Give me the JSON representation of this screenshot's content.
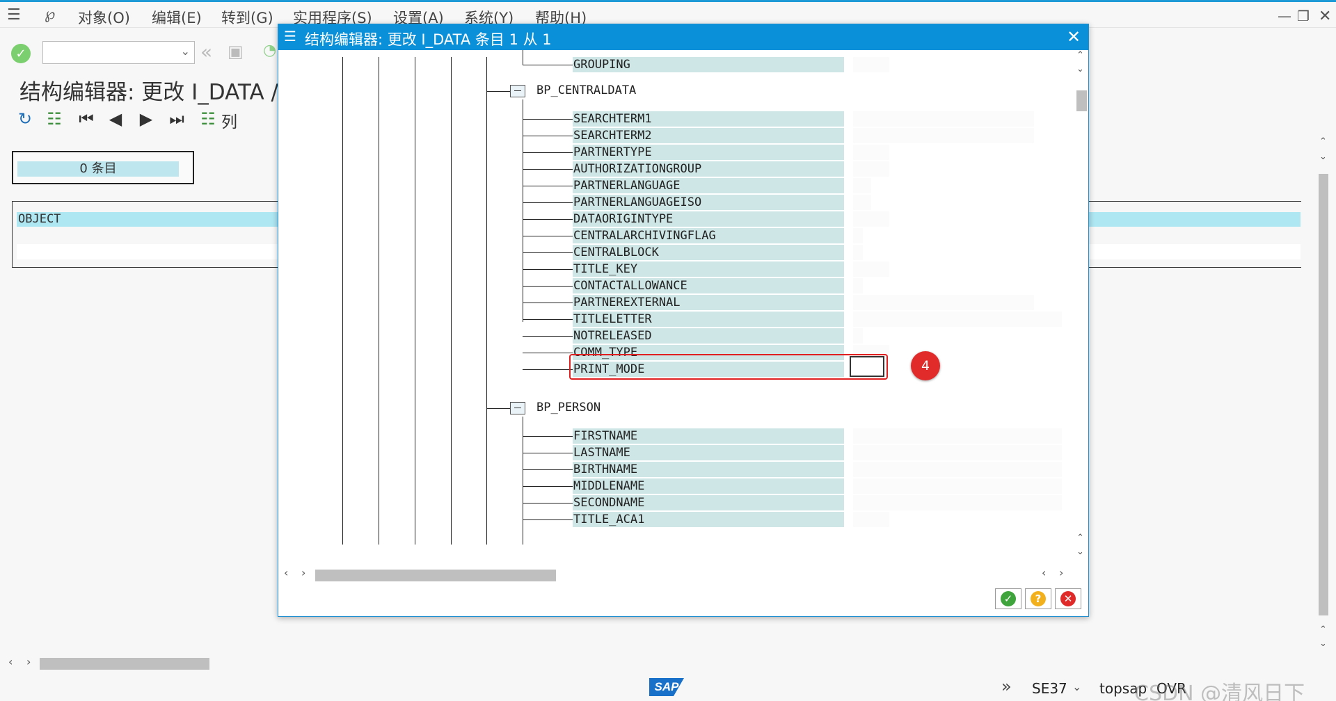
{
  "menubar": {
    "items": [
      "对象(O)",
      "编辑(E)",
      "转到(G)",
      "实用程序(S)",
      "设置(A)",
      "系统(Y)",
      "帮助(H)"
    ]
  },
  "window": {
    "title": "结构编辑器: 更改 I_DATA /",
    "column_button": "列",
    "entry_count": "0  条目",
    "object_header": "OBJECT"
  },
  "dialog": {
    "title": "结构编辑器: 更改 I_DATA 条目 1 从 1",
    "nodes": [
      {
        "label": "BP_CENTRALDATA"
      },
      {
        "label": "BP_PERSON"
      }
    ],
    "top_field": "GROUPING",
    "centraldata_fields": [
      "SEARCHTERM1",
      "SEARCHTERM2",
      "PARTNERTYPE",
      "AUTHORIZATIONGROUP",
      "PARTNERLANGUAGE",
      "PARTNERLANGUAGEISO",
      "DATAORIGINTYPE",
      "CENTRALARCHIVINGFLAG",
      "CENTRALBLOCK",
      "TITLE_KEY",
      "CONTACTALLOWANCE",
      "PARTNEREXTERNAL",
      "TITLELETTER",
      "NOTRELEASED",
      "COMM_TYPE",
      "PRINT_MODE"
    ],
    "person_fields": [
      "FIRSTNAME",
      "LASTNAME",
      "BIRTHNAME",
      "MIDDLENAME",
      "SECONDNAME",
      "TITLE_ACA1"
    ],
    "annotation_badge": "4"
  },
  "statusbar": {
    "transaction": "SE37",
    "system": "topsap",
    "mode": "OVR",
    "watermark": "CSDN @清风日下"
  },
  "colors": {
    "header_blue": "#0a8fd9",
    "field_bg": "#cfe6e6",
    "highlight_red": "#e02020"
  }
}
